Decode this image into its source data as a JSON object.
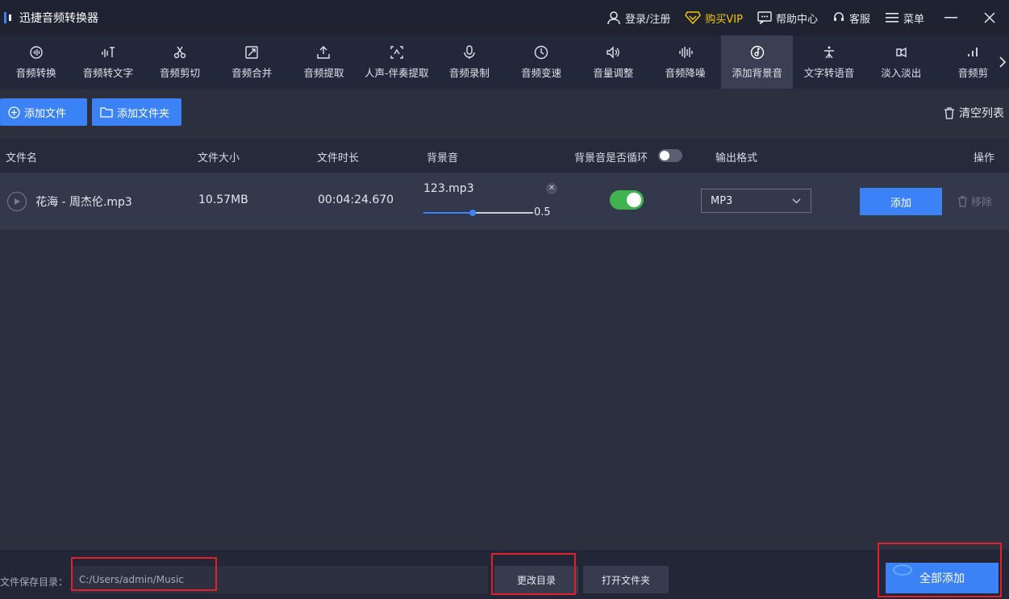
{
  "app": {
    "title": "迅捷音频转换器"
  },
  "title_actions": {
    "login": "登录/注册",
    "vip": "购买VIP",
    "help": "帮助中心",
    "service": "客服",
    "menu": "菜单"
  },
  "tools": [
    {
      "label": "音频转换",
      "icon": "audio-convert-icon"
    },
    {
      "label": "音频转文字",
      "icon": "audio-to-text-icon"
    },
    {
      "label": "音频剪切",
      "icon": "scissors-icon"
    },
    {
      "label": "音频合并",
      "icon": "merge-icon"
    },
    {
      "label": "音频提取",
      "icon": "extract-icon"
    },
    {
      "label": "人声-伴奏提取",
      "icon": "vocal-extract-icon"
    },
    {
      "label": "音频录制",
      "icon": "microphone-icon"
    },
    {
      "label": "音频变速",
      "icon": "speed-icon"
    },
    {
      "label": "音量调整",
      "icon": "volume-icon"
    },
    {
      "label": "音频降噪",
      "icon": "denoise-icon"
    },
    {
      "label": "添加背景音",
      "icon": "background-music-icon",
      "active": true
    },
    {
      "label": "文字转语音",
      "icon": "text-to-speech-icon"
    },
    {
      "label": "淡入淡出",
      "icon": "fade-icon"
    },
    {
      "label": "音频剪",
      "icon": "audio-bars-icon"
    }
  ],
  "actions": {
    "add_file": "添加文件",
    "add_folder": "添加文件夹",
    "clear_list": "清空列表"
  },
  "table": {
    "headers": {
      "filename": "文件名",
      "size": "文件大小",
      "duration": "文件时长",
      "bg_sound": "背景音",
      "loop": "背景音是否循环",
      "format": "输出格式",
      "ops": "操作"
    },
    "rows": [
      {
        "filename": "花海 - 周杰伦.mp3",
        "size": "10.57MB",
        "duration": "00:04:24.670",
        "bg_file": "123.mp3",
        "bg_volume": 0.5,
        "bg_volume_label": "0.5",
        "loop_on": true,
        "format": "MP3",
        "add_label": "添加",
        "remove_label": "移除"
      }
    ]
  },
  "bottom": {
    "save_label": "文件保存目录：",
    "save_path": "C:/Users/admin/Music",
    "change_dir": "更改目录",
    "open_folder": "打开文件夹",
    "add_all": "全部添加"
  },
  "colors": {
    "accent": "#3b82f6",
    "toggle_on": "#3fb34f",
    "vip": "#f5c400",
    "highlight": "#e0202a"
  }
}
